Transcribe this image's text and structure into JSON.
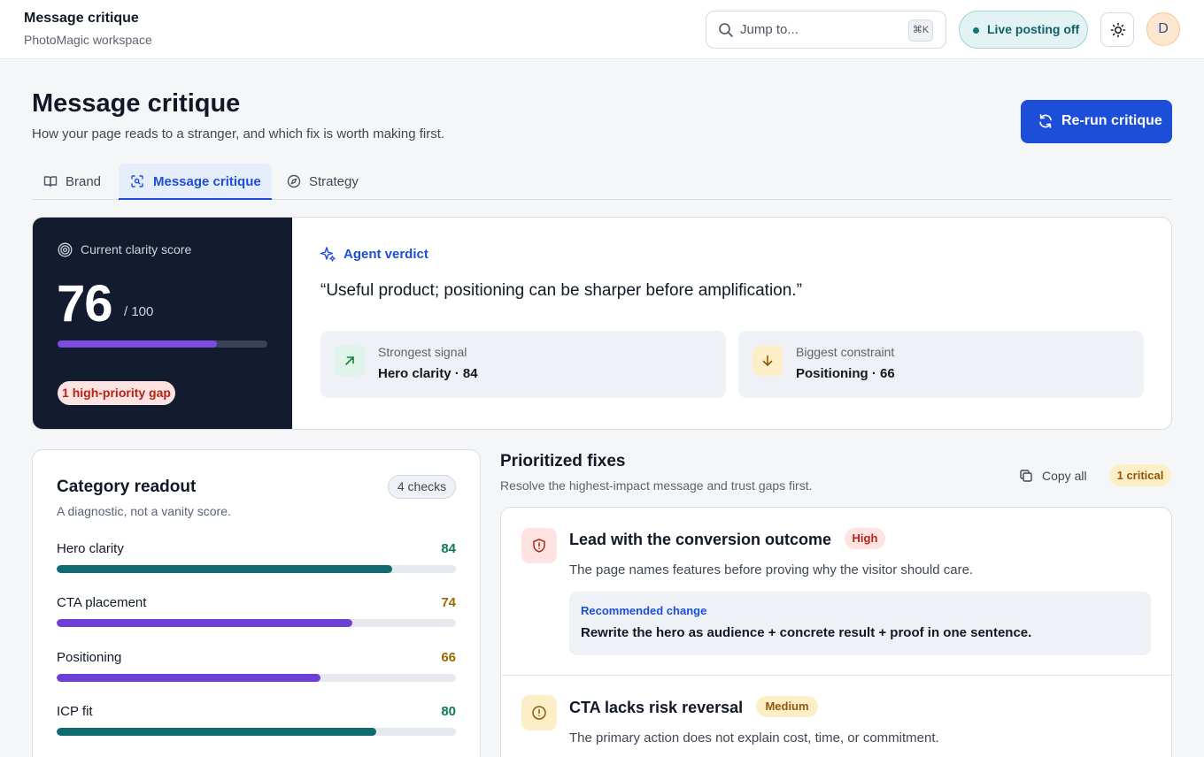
{
  "header": {
    "workspace_title": "Message critique",
    "workspace_name": "PhotoMagic workspace",
    "search": {
      "placeholder": "Jump to...",
      "shortcut": "⌘K"
    },
    "live_posting": "Live posting off",
    "avatar_initial": "D"
  },
  "page": {
    "title": "Message critique",
    "subtitle": "How your page reads to a stranger, and which fix is worth making first.",
    "rerun_label": "Re-run critique"
  },
  "tabs": [
    {
      "label": "Brand",
      "icon": "book-icon",
      "active": false
    },
    {
      "label": "Message critique",
      "icon": "scan-icon",
      "active": true
    },
    {
      "label": "Strategy",
      "icon": "compass-icon",
      "active": false
    }
  ],
  "score": {
    "label": "Current clarity score",
    "value": "76",
    "max": "/ 100",
    "fraction": 0.76,
    "gap_badge": "1 high-priority gap"
  },
  "verdict": {
    "heading": "Agent verdict",
    "quote": "“Useful product; positioning can be sharper before amplification.”",
    "strongest": {
      "label": "Strongest signal",
      "value": "Hero clarity · 84"
    },
    "constraint": {
      "label": "Biggest constraint",
      "value": "Positioning · 66"
    }
  },
  "categories": {
    "title": "Category readout",
    "subtitle": "A diagnostic, not a vanity score.",
    "checks": "4 checks",
    "items": [
      {
        "name": "Hero clarity",
        "score": "84",
        "fraction": 0.84,
        "bar_color": "#0f6b70",
        "score_color": "#0f7a55"
      },
      {
        "name": "CTA placement",
        "score": "74",
        "fraction": 0.74,
        "bar_color": "#6d3fd6",
        "score_color": "#9a6a00"
      },
      {
        "name": "Positioning",
        "score": "66",
        "fraction": 0.66,
        "bar_color": "#6d3fd6",
        "score_color": "#9a6a00"
      },
      {
        "name": "ICP fit",
        "score": "80",
        "fraction": 0.8,
        "bar_color": "#0f6b70",
        "score_color": "#0f7a55"
      }
    ]
  },
  "fixes": {
    "title": "Prioritized fixes",
    "subtitle": "Resolve the highest-impact message and trust gaps first.",
    "copy_all": "Copy all",
    "critical_badge": "1 critical",
    "items": [
      {
        "title": "Lead with the conversion outcome",
        "severity": "High",
        "description": "The page names features before proving why the visitor should care.",
        "recommendation_label": "Recommended change",
        "recommendation": "Rewrite the hero as audience + concrete result + proof in one sentence."
      },
      {
        "title": "CTA lacks risk reversal",
        "severity": "Medium",
        "description": "The primary action does not explain cost, time, or commitment."
      }
    ]
  },
  "colors": {
    "accent": "#1d4ed8",
    "score_panel": "#131c2e",
    "score_fill": "#7c4de0",
    "high": "#b42318",
    "medium": "#92560b"
  }
}
